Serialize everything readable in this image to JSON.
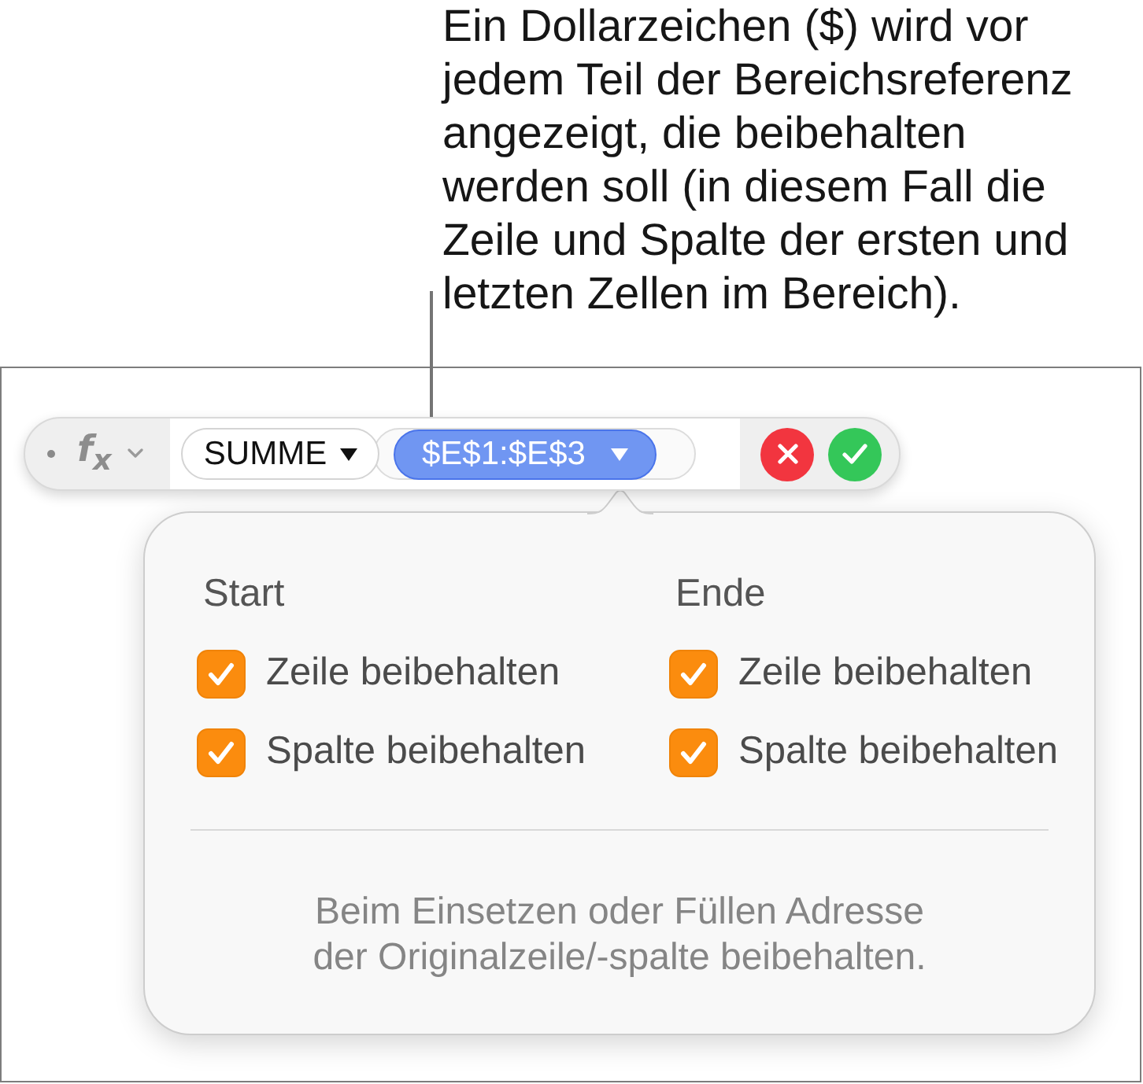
{
  "callout": {
    "text": "Ein Dollarzeichen ($) wird vor\njedem Teil der Bereichsreferenz\nangezeigt, die beibehalten\nwerden soll (in diesem Fall die\nZeile und Spalte der ersten und\nletzten Zellen im Bereich)."
  },
  "formula_bar": {
    "function_symbol": "f$_{x}$",
    "tokens": [
      {
        "kind": "function",
        "label": "SUMME",
        "selected": false
      },
      {
        "kind": "range",
        "label": "$E$1:$E$3",
        "selected": true
      }
    ]
  },
  "popover": {
    "columns": [
      {
        "heading": "Start",
        "options": [
          {
            "label": "Zeile beibehalten",
            "checked": true
          },
          {
            "label": "Spalte beibehalten",
            "checked": true
          }
        ]
      },
      {
        "heading": "Ende",
        "options": [
          {
            "label": "Zeile beibehalten",
            "checked": true
          },
          {
            "label": "Spalte beibehalten",
            "checked": true
          }
        ]
      }
    ],
    "note": "Beim Einsetzen oder Füllen Adresse\nder Originalzeile/-spalte beibehalten."
  }
}
